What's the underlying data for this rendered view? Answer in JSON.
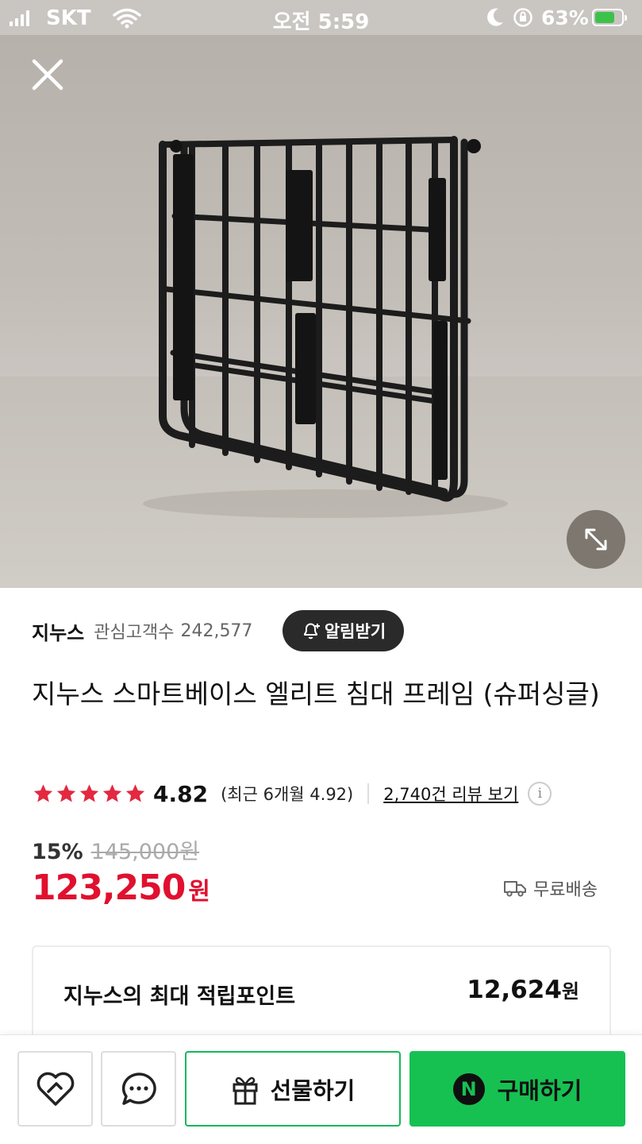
{
  "status_bar": {
    "carrier": "SKT",
    "time": "오전 5:59",
    "battery_percent": "63%"
  },
  "gallery": {
    "image_count": 7,
    "active_index": 5
  },
  "seller": {
    "name": "지누스",
    "fans_label": "관심고객수",
    "fans_count": "242,577",
    "alarm_button": "알림받기"
  },
  "product": {
    "title": "지누스 스마트베이스 엘리트 침대 프레임 (슈퍼싱글)",
    "rating": "4.82",
    "rating_value": 4.82,
    "recent_rating": "(최근 6개월 4.92)",
    "review_link": "2,740건 리뷰 보기",
    "discount": "15%",
    "original_price": "145,000원",
    "price": "123,250",
    "price_unit": "원",
    "shipping": "무료배송"
  },
  "points": {
    "label": "지누스의 최대 적립포인트",
    "value": "12,624",
    "unit": "원"
  },
  "bottom_bar": {
    "gift_label": "선물하기",
    "buy_label": "구매하기",
    "npay_badge": "N"
  },
  "colors": {
    "price_red": "#e0102f",
    "star_red": "#e32840",
    "naver_green": "#16c152"
  }
}
